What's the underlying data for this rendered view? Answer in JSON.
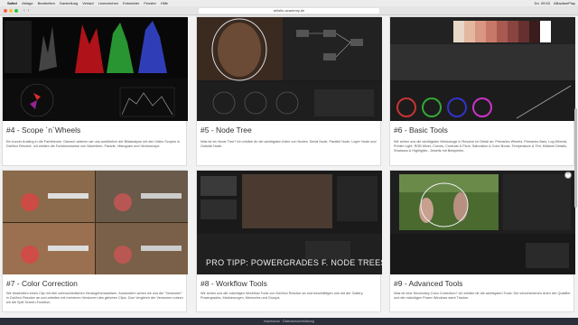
{
  "menubar": {
    "items": [
      "Safari",
      "Ablage",
      "Bearbeiten",
      "Darstellung",
      "Verlauf",
      "Lesezeichen",
      "Entwickler",
      "Fenster",
      "Hilfe"
    ],
    "clock": "Do. 09:53",
    "user": "ABadiamPlay"
  },
  "browser": {
    "url": "artistic-academy.de"
  },
  "cards": [
    {
      "title": "#4 - Scope ´n´Wheels",
      "desc": "Ein kurzer Ausflug in die Farbtheorie. Danach widmen wir uns ausführlich der Bildanalyse mit den Video Scopes in DaVinci Resolve. Ich erkläre die Funktionsweise von Waveform, Parade, Histogram und Vectorscope."
    },
    {
      "title": "#5 - Node Tree",
      "desc": "Was ist ein Node Tree? Ich erkläre dir die wichtigsten Arten von Nodes: Serial Node, Parallel Node, Layer Node und Outside Node."
    },
    {
      "title": "#6 - Basic Tools",
      "desc": "Wir sehen uns die wichtigsten Werkzeuge in Resolve im Detail an: Primaries Wheels, Primaries Bars, Log Wheels, Printer Light, RGB Mixer, Curves, Contrast & Pivot, Saturation & Color Boost, Temperature & Tint, Midtone Details, Shadows & Highlights.. Jeweils mit Beispielen."
    },
    {
      "title": "#7 - Color Correction",
      "desc": "Wir bearbeiten einen Clip mit drei unterschiedlichen Herangehensweisen. Ausserdem sehen wir uns die \"Versionen\" in DaVinci Resolve an und arbeiten mit mehreren Versionen des gleichen Clips. Zum Vergleich der Versionen nutzen wir die Split Screen-Funktion."
    },
    {
      "title": "#8 - Workflow Tools",
      "desc": "Wir sehen uns die mächtigen Workflow Tools von DaVinci Resolve an und beschäftigen uns mit der Gallery, Powergrades, Markierungen, Memories und Groups.",
      "overlay": "PRO TIPP: POWERGRADES F. NODE TREES"
    },
    {
      "title": "#9 - Advanced Tools",
      "desc": "Was ist eine Secondary Color Correction? Ich erkläre dir die wichtigsten Tools: Die verschiedenen Arten der Qualifier und die mächtigen Power Windows samt Tracker."
    }
  ],
  "footer": {
    "text": "Impressum · Datenschutzerklärung"
  },
  "colors": {
    "menubar": "#ececec",
    "page": "#f2f2f2",
    "footer": "#2a2f3a"
  }
}
